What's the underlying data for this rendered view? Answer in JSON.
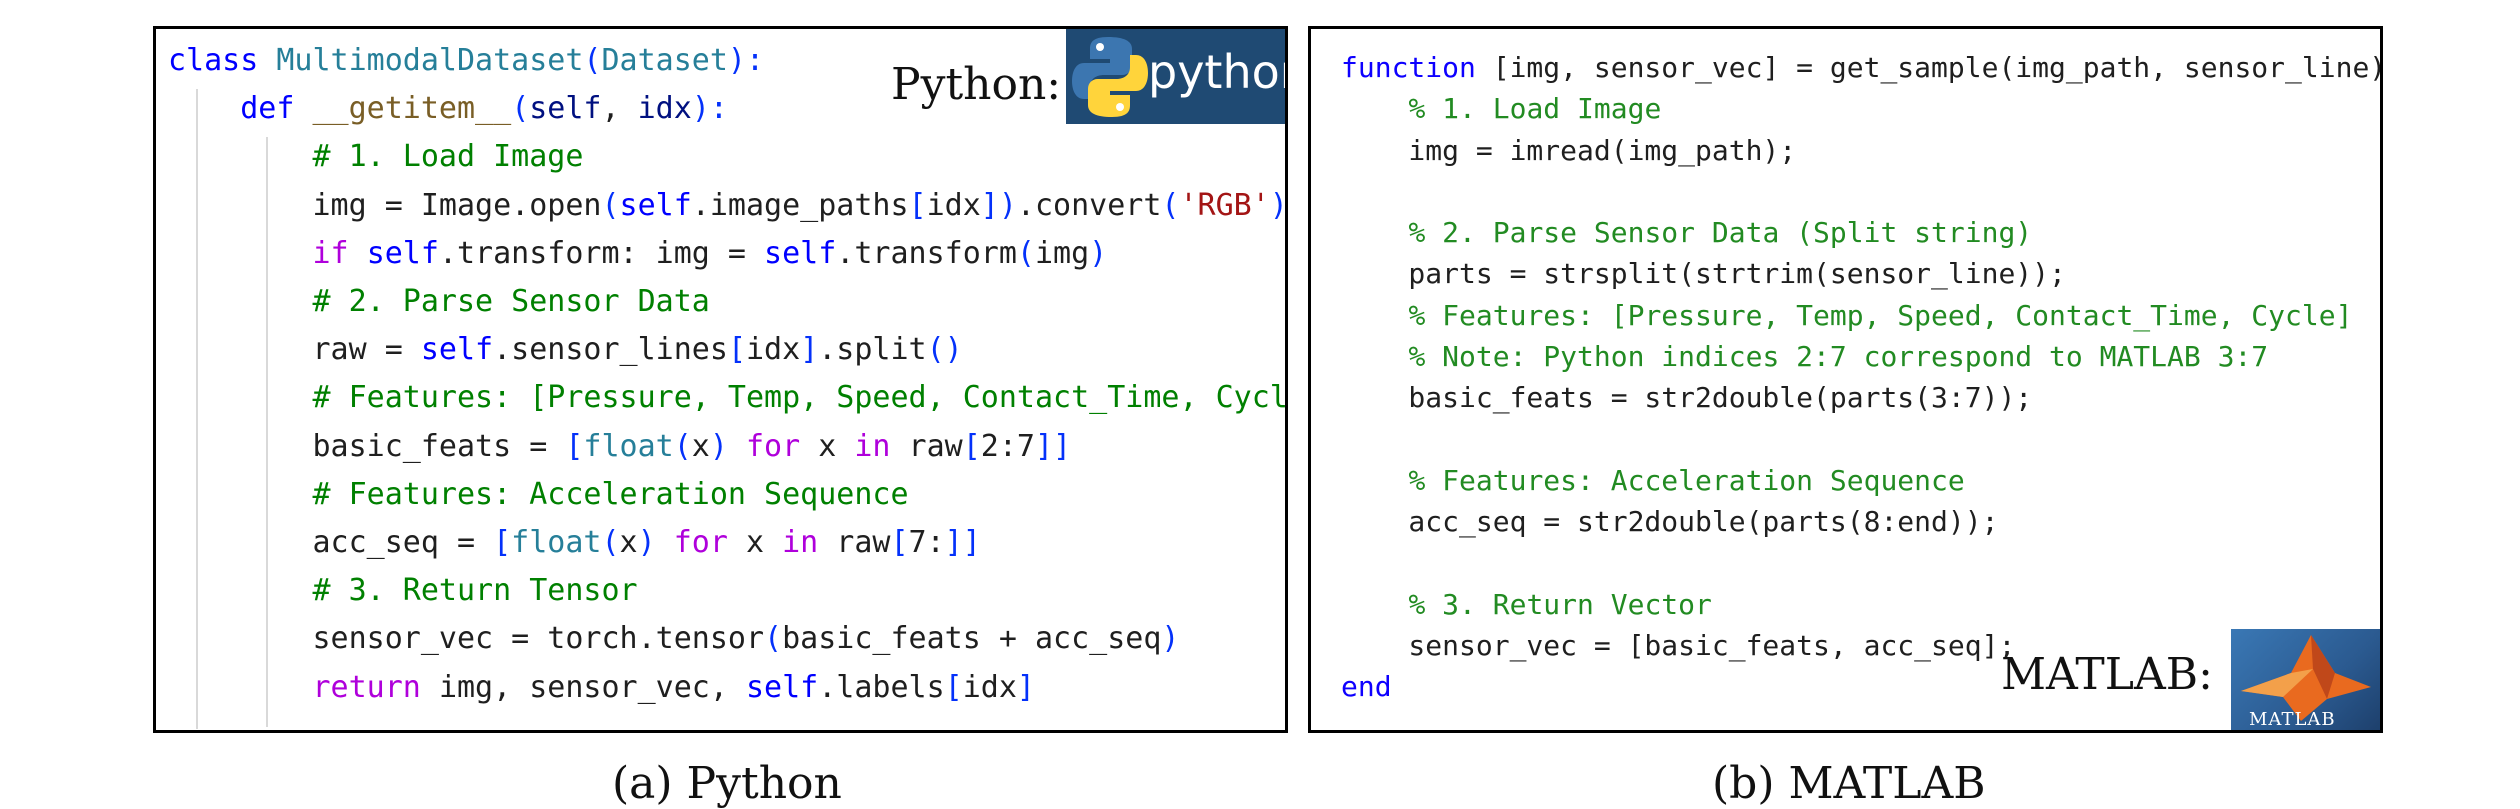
{
  "python_panel": {
    "label": "Python:",
    "logo_text": "python",
    "lines": [
      [
        {
          "t": "class ",
          "c": "tok-kw-blue"
        },
        {
          "t": "MultimodalDataset",
          "c": "tok-class"
        },
        {
          "t": "(",
          "c": "tok-bracket"
        },
        {
          "t": "Dataset",
          "c": "tok-class"
        },
        {
          "t": "):",
          "c": "tok-bracket"
        }
      ],
      [
        {
          "t": "    ",
          "c": "tok-plain"
        },
        {
          "t": "def ",
          "c": "tok-kw-blue"
        },
        {
          "t": "__getitem__",
          "c": "tok-func"
        },
        {
          "t": "(",
          "c": "tok-bracket"
        },
        {
          "t": "self",
          "c": "tok-param"
        },
        {
          "t": ", ",
          "c": "tok-plain"
        },
        {
          "t": "idx",
          "c": "tok-param"
        },
        {
          "t": "):",
          "c": "tok-bracket"
        }
      ],
      [
        {
          "t": "        ",
          "c": "tok-plain"
        },
        {
          "t": "# 1. Load Image",
          "c": "tok-comment"
        }
      ],
      [
        {
          "t": "        img = Image.open",
          "c": "tok-plain"
        },
        {
          "t": "(",
          "c": "tok-bracket"
        },
        {
          "t": "self",
          "c": "tok-self"
        },
        {
          "t": ".image_paths",
          "c": "tok-plain"
        },
        {
          "t": "[",
          "c": "tok-bracket"
        },
        {
          "t": "idx",
          "c": "tok-plain"
        },
        {
          "t": "]",
          "c": "tok-bracket"
        },
        {
          "t": ")",
          "c": "tok-bracket"
        },
        {
          "t": ".convert",
          "c": "tok-plain"
        },
        {
          "t": "(",
          "c": "tok-bracket"
        },
        {
          "t": "'RGB'",
          "c": "tok-string"
        },
        {
          "t": ")",
          "c": "tok-bracket"
        }
      ],
      [
        {
          "t": "        ",
          "c": "tok-plain"
        },
        {
          "t": "if ",
          "c": "tok-kw-purple"
        },
        {
          "t": "self",
          "c": "tok-self"
        },
        {
          "t": ".transform: img = ",
          "c": "tok-plain"
        },
        {
          "t": "self",
          "c": "tok-self"
        },
        {
          "t": ".transform",
          "c": "tok-plain"
        },
        {
          "t": "(",
          "c": "tok-bracket"
        },
        {
          "t": "img",
          "c": "tok-plain"
        },
        {
          "t": ")",
          "c": "tok-bracket"
        }
      ],
      [
        {
          "t": "        ",
          "c": "tok-plain"
        },
        {
          "t": "# 2. Parse Sensor Data",
          "c": "tok-comment"
        }
      ],
      [
        {
          "t": "        raw = ",
          "c": "tok-plain"
        },
        {
          "t": "self",
          "c": "tok-self"
        },
        {
          "t": ".sensor_lines",
          "c": "tok-plain"
        },
        {
          "t": "[",
          "c": "tok-bracket"
        },
        {
          "t": "idx",
          "c": "tok-plain"
        },
        {
          "t": "]",
          "c": "tok-bracket"
        },
        {
          "t": ".split",
          "c": "tok-plain"
        },
        {
          "t": "()",
          "c": "tok-bracket"
        }
      ],
      [
        {
          "t": "        ",
          "c": "tok-plain"
        },
        {
          "t": "# Features: [Pressure, Temp, Speed, Contact_Time, Cycle]",
          "c": "tok-comment"
        }
      ],
      [
        {
          "t": "        basic_feats = ",
          "c": "tok-plain"
        },
        {
          "t": "[",
          "c": "tok-bracket"
        },
        {
          "t": "float",
          "c": "tok-builtin"
        },
        {
          "t": "(",
          "c": "tok-bracket"
        },
        {
          "t": "x",
          "c": "tok-plain"
        },
        {
          "t": ")",
          "c": "tok-bracket"
        },
        {
          "t": " for ",
          "c": "tok-kw-purple"
        },
        {
          "t": "x",
          "c": "tok-plain"
        },
        {
          "t": " in ",
          "c": "tok-kw-purple"
        },
        {
          "t": "raw",
          "c": "tok-plain"
        },
        {
          "t": "[",
          "c": "tok-bracket"
        },
        {
          "t": "2:7",
          "c": "tok-plain"
        },
        {
          "t": "]]",
          "c": "tok-bracket"
        }
      ],
      [
        {
          "t": "        ",
          "c": "tok-plain"
        },
        {
          "t": "# Features: Acceleration Sequence",
          "c": "tok-comment"
        }
      ],
      [
        {
          "t": "        acc_seq = ",
          "c": "tok-plain"
        },
        {
          "t": "[",
          "c": "tok-bracket"
        },
        {
          "t": "float",
          "c": "tok-builtin"
        },
        {
          "t": "(",
          "c": "tok-bracket"
        },
        {
          "t": "x",
          "c": "tok-plain"
        },
        {
          "t": ")",
          "c": "tok-bracket"
        },
        {
          "t": " for ",
          "c": "tok-kw-purple"
        },
        {
          "t": "x",
          "c": "tok-plain"
        },
        {
          "t": " in ",
          "c": "tok-kw-purple"
        },
        {
          "t": "raw",
          "c": "tok-plain"
        },
        {
          "t": "[",
          "c": "tok-bracket"
        },
        {
          "t": "7:",
          "c": "tok-plain"
        },
        {
          "t": "]]",
          "c": "tok-bracket"
        }
      ],
      [
        {
          "t": "        ",
          "c": "tok-plain"
        },
        {
          "t": "# 3. Return Tensor",
          "c": "tok-comment"
        }
      ],
      [
        {
          "t": "        sensor_vec = torch.tensor",
          "c": "tok-plain"
        },
        {
          "t": "(",
          "c": "tok-bracket"
        },
        {
          "t": "basic_feats + acc_seq",
          "c": "tok-plain"
        },
        {
          "t": ")",
          "c": "tok-bracket"
        }
      ],
      [
        {
          "t": "        ",
          "c": "tok-plain"
        },
        {
          "t": "return ",
          "c": "tok-kw-purple"
        },
        {
          "t": "img, sensor_vec, ",
          "c": "tok-plain"
        },
        {
          "t": "self",
          "c": "tok-self"
        },
        {
          "t": ".labels",
          "c": "tok-plain"
        },
        {
          "t": "[",
          "c": "tok-bracket"
        },
        {
          "t": "idx",
          "c": "tok-plain"
        },
        {
          "t": "]",
          "c": "tok-bracket"
        }
      ]
    ]
  },
  "matlab_panel": {
    "label": "MATLAB:",
    "logo_text": "MATLAB",
    "lines": [
      [
        {
          "t": "function ",
          "c": "ml-kw"
        },
        {
          "t": "[img, sensor_vec] = get_sample(img_path, sensor_line)",
          "c": "tok-plain"
        }
      ],
      [
        {
          "t": "    ",
          "c": "tok-plain"
        },
        {
          "t": "% 1. Load Image",
          "c": "ml-comment"
        }
      ],
      [
        {
          "t": "    img = imread(img_path);",
          "c": "tok-plain"
        }
      ],
      [
        {
          "t": "",
          "c": "tok-plain"
        }
      ],
      [
        {
          "t": "    ",
          "c": "tok-plain"
        },
        {
          "t": "% 2. Parse Sensor Data (Split string)",
          "c": "ml-comment"
        }
      ],
      [
        {
          "t": "    parts = strsplit(strtrim(sensor_line));",
          "c": "tok-plain"
        }
      ],
      [
        {
          "t": "    ",
          "c": "tok-plain"
        },
        {
          "t": "% Features: [Pressure, Temp, Speed, Contact_Time, Cycle]",
          "c": "ml-comment"
        }
      ],
      [
        {
          "t": "    ",
          "c": "tok-plain"
        },
        {
          "t": "% Note: Python indices 2:7 correspond to MATLAB 3:7",
          "c": "ml-comment"
        }
      ],
      [
        {
          "t": "    basic_feats = str2double(parts(3:7));",
          "c": "tok-plain"
        }
      ],
      [
        {
          "t": "",
          "c": "tok-plain"
        }
      ],
      [
        {
          "t": "    ",
          "c": "tok-plain"
        },
        {
          "t": "% Features: Acceleration Sequence",
          "c": "ml-comment"
        }
      ],
      [
        {
          "t": "    acc_seq = str2double(parts(8:end));",
          "c": "tok-plain"
        }
      ],
      [
        {
          "t": "",
          "c": "tok-plain"
        }
      ],
      [
        {
          "t": "    ",
          "c": "tok-plain"
        },
        {
          "t": "% 3. Return Vector",
          "c": "ml-comment"
        }
      ],
      [
        {
          "t": "    sensor_vec = [basic_feats, acc_seq];",
          "c": "tok-plain"
        }
      ],
      [
        {
          "t": "end",
          "c": "ml-kw"
        }
      ]
    ]
  },
  "captions": {
    "a": "(a) Python",
    "b": "(b) MATLAB"
  }
}
